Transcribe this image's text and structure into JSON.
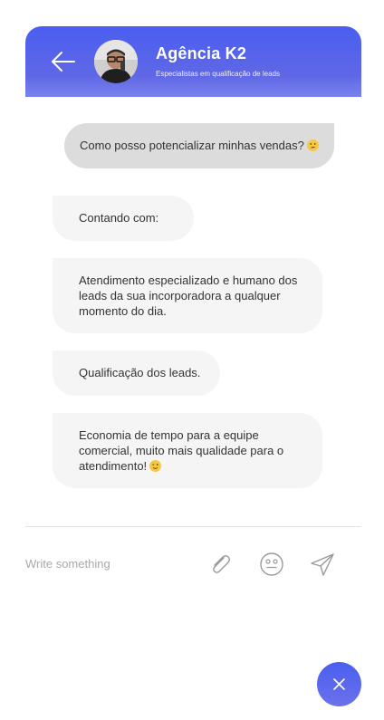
{
  "header": {
    "title": "Agência K2",
    "subtitle": "Especialistas em qualificação de leads",
    "back_icon": "arrow-left-icon",
    "avatar": "agent-avatar"
  },
  "messages": [
    {
      "sender": "user",
      "text": "Como posso potencializar minhas vendas?",
      "emoji": "thinking-face"
    },
    {
      "sender": "agent",
      "text": "Contando com:"
    },
    {
      "sender": "agent",
      "text": "Atendimento especializado e humano dos leads da sua incorporadora a qualquer momento do dia."
    },
    {
      "sender": "agent",
      "text": "Qualificação dos leads."
    },
    {
      "sender": "agent",
      "text": "Economia de tempo para a equipe comercial, muito mais qualidade para o atendimento!",
      "emoji": "winking-face"
    }
  ],
  "composer": {
    "placeholder": "Write something",
    "attach_icon": "paperclip-icon",
    "emoji_icon": "smiley-icon",
    "send_icon": "paper-plane-icon"
  },
  "fab": {
    "icon": "close-icon"
  },
  "colors": {
    "accent": "#4a5ef0",
    "user_bubble": "#dcdcdc",
    "agent_bubble": "#f5f5f5",
    "emoji": "#f5c842"
  }
}
